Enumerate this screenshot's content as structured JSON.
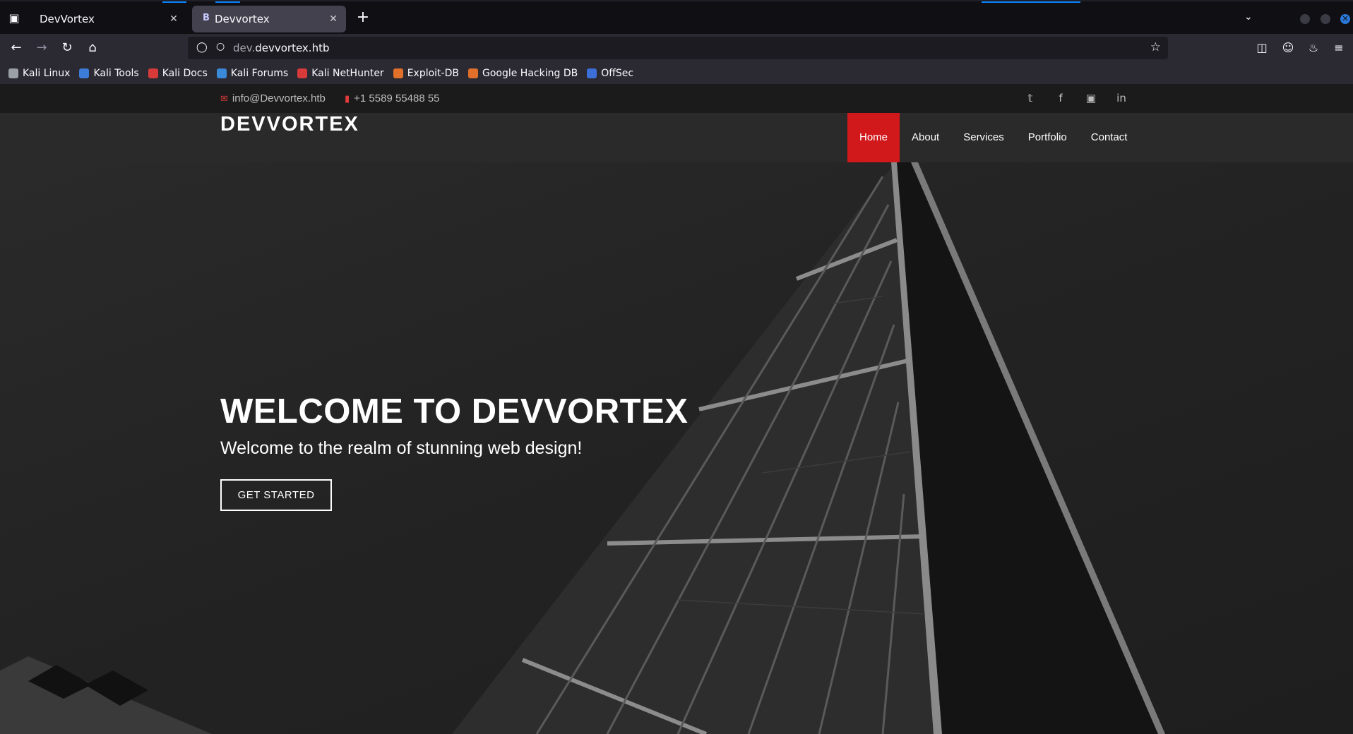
{
  "browser": {
    "tabs": [
      {
        "title": "DevVortex",
        "active": false
      },
      {
        "title": "Devvortex",
        "active": true,
        "favicon_letter": "B"
      }
    ],
    "url_subdomain": "dev.",
    "url_domain": "devvortex.htb",
    "bookmarks": [
      {
        "label": "Kali Linux",
        "icon": "kali-dragon-icon",
        "color": "#9aa0a6"
      },
      {
        "label": "Kali Tools",
        "icon": "kali-tools-icon",
        "color": "#3d7bd9"
      },
      {
        "label": "Kali Docs",
        "icon": "kali-docs-icon",
        "color": "#d83a3a"
      },
      {
        "label": "Kali Forums",
        "icon": "kali-forums-icon",
        "color": "#3a88d8"
      },
      {
        "label": "Kali NetHunter",
        "icon": "nethunter-icon",
        "color": "#d83a3a"
      },
      {
        "label": "Exploit-DB",
        "icon": "exploit-db-icon",
        "color": "#e0702a"
      },
      {
        "label": "Google Hacking DB",
        "icon": "ghdb-icon",
        "color": "#e0702a"
      },
      {
        "label": "OffSec",
        "icon": "offsec-icon",
        "color": "#3d6fd9"
      }
    ]
  },
  "site": {
    "email": "info@Devvortex.htb",
    "phone": "+1 5589 55488 55",
    "social_icons": [
      "twitter-icon",
      "facebook-icon",
      "instagram-icon",
      "linkedin-icon"
    ],
    "logo": "DEVVORTEX",
    "menu": [
      {
        "label": "Home",
        "active": true
      },
      {
        "label": "About",
        "active": false
      },
      {
        "label": "Services",
        "active": false
      },
      {
        "label": "Portfolio",
        "active": false
      },
      {
        "label": "Contact",
        "active": false
      }
    ],
    "hero": {
      "title": "WELCOME TO DEVVORTEX",
      "subtitle": "Welcome to the realm of stunning web design!",
      "button": "GET STARTED"
    },
    "accent_color": "#d1181b"
  }
}
